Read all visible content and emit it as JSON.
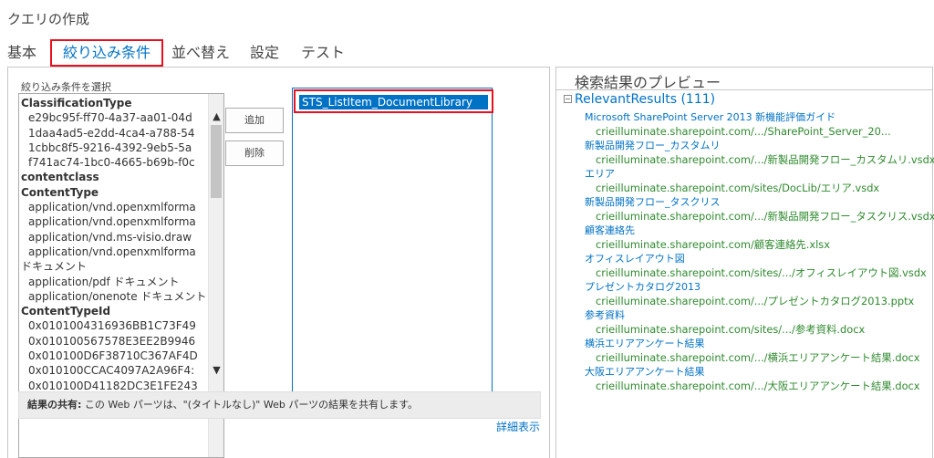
{
  "page_title": "クエリの作成",
  "tabs": [
    {
      "label": "基本"
    },
    {
      "label": "絞り込み条件"
    },
    {
      "label": "並べ替え"
    },
    {
      "label": "設定"
    },
    {
      "label": "テスト"
    }
  ],
  "active_tab": "絞り込み条件",
  "filter": {
    "select_label": "絞り込み条件を選択",
    "list_items": [
      {
        "text": "ClassificationType",
        "group": true
      },
      {
        "text": "e29bc95f-ff70-4a37-aa01-04d",
        "group": false
      },
      {
        "text": "1daa4ad5-e2dd-4ca4-a788-54",
        "group": false
      },
      {
        "text": "1cbbc8f5-9216-4392-9eb5-5a",
        "group": false
      },
      {
        "text": "f741ac74-1bc0-4665-b69b-f0c",
        "group": false
      },
      {
        "text": "contentclass",
        "group": true
      },
      {
        "text": "ContentType",
        "group": true
      },
      {
        "text": "application/vnd.openxmlforma",
        "group": false
      },
      {
        "text": "application/vnd.openxmlforma",
        "group": false
      },
      {
        "text": "application/vnd.ms-visio.draw",
        "group": false
      },
      {
        "text": "application/vnd.openxmlforma",
        "group": false
      },
      {
        "text": "ドキュメント",
        "group": false,
        "wrap": true
      },
      {
        "text": "application/pdf ドキュメント",
        "group": false
      },
      {
        "text": "application/onenote ドキュメント",
        "group": false
      },
      {
        "text": "ContentTypeId",
        "group": true
      },
      {
        "text": "0x0101004316936BB1C73F49",
        "group": false
      },
      {
        "text": "0x010100567578E3EE2B9946",
        "group": false
      },
      {
        "text": "0x010100D6F38710C367AF4D",
        "group": false
      },
      {
        "text": "0x010100CCAC4097A2A96F4:",
        "group": false
      },
      {
        "text": "0x010100D41182DC3E1FE243",
        "group": false
      }
    ],
    "scroll_up_glyph": "▲",
    "scroll_down_glyph": "▼",
    "add_button": "追加",
    "delete_button": "削除",
    "selected_items": [
      "STS_ListItem_DocumentLibrary"
    ],
    "share_label": "結果の共有:",
    "share_text": "この Web パーツは、\"(タイトルなし)\" Web パーツの結果を共有します。",
    "advanced_link": "詳細表示"
  },
  "preview": {
    "title": "検索結果のプレビュー",
    "collapse_glyph": "−",
    "results_heading": "RelevantResults (111)",
    "results": [
      {
        "title": "Microsoft SharePoint Server 2013 新機能評価ガイド",
        "url": "crieilluminate.sharepoint.com/.../SharePoint_Server_20..."
      },
      {
        "title": "新製品開発フロー_カスタムリ",
        "url": "crieilluminate.sharepoint.com/.../新製品開発フロー_カスタムリ.vsdx"
      },
      {
        "title": "エリア",
        "url": "crieilluminate.sharepoint.com/sites/DocLib/エリア.vsdx"
      },
      {
        "title": "新製品開発フロー_タスクリス",
        "url": "crieilluminate.sharepoint.com/.../新製品開発フロー_タスクリス.vsdx"
      },
      {
        "title": "顧客連絡先",
        "url": "crieilluminate.sharepoint.com/顧客連絡先.xlsx"
      },
      {
        "title": "オフィスレイアウト図",
        "url": "crieilluminate.sharepoint.com/sites/.../オフィスレイアウト図.vsdx"
      },
      {
        "title": "プレゼントカタログ2013",
        "url": "crieilluminate.sharepoint.com/.../プレゼントカタログ2013.pptx"
      },
      {
        "title": "参考資料",
        "url": "crieilluminate.sharepoint.com/sites/.../参考資料.docx"
      },
      {
        "title": "横浜エリアアンケート結果",
        "url": "crieilluminate.sharepoint.com/.../横浜エリアアンケート結果.docx"
      },
      {
        "title": "大阪エリアアンケート結果",
        "url": "crieilluminate.sharepoint.com/.../大阪エリアアンケート結果.docx"
      }
    ]
  },
  "colors": {
    "accent": "#0072c6",
    "highlight_border": "#e8101e",
    "url_green": "#2f8a2f"
  }
}
